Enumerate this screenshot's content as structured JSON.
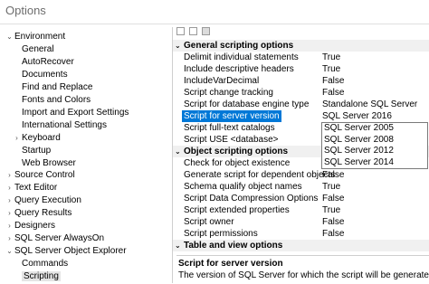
{
  "window": {
    "title": "Options"
  },
  "tree": {
    "nodes": [
      {
        "label": "Environment",
        "arrow": "⌄"
      },
      {
        "label": "General"
      },
      {
        "label": "AutoRecover"
      },
      {
        "label": "Documents"
      },
      {
        "label": "Find and Replace"
      },
      {
        "label": "Fonts and Colors"
      },
      {
        "label": "Import and Export Settings"
      },
      {
        "label": "International Settings"
      },
      {
        "label": "Keyboard",
        "arrow": "›"
      },
      {
        "label": "Startup"
      },
      {
        "label": "Web Browser"
      },
      {
        "label": "Source Control",
        "arrow": "›"
      },
      {
        "label": "Text Editor",
        "arrow": "›"
      },
      {
        "label": "Query Execution",
        "arrow": "›"
      },
      {
        "label": "Query Results",
        "arrow": "›"
      },
      {
        "label": "Designers",
        "arrow": "›"
      },
      {
        "label": "SQL Server AlwaysOn",
        "arrow": "›"
      },
      {
        "label": "SQL Server Object Explorer",
        "arrow": "⌄"
      },
      {
        "label": "Commands"
      },
      {
        "label": "Scripting"
      }
    ]
  },
  "grid": {
    "categories": {
      "general": "General scripting options",
      "object": "Object scripting options",
      "table": "Table and view options"
    },
    "rows": [
      {
        "name": "Delimit individual statements",
        "value": "True"
      },
      {
        "name": "Include descriptive headers",
        "value": "True"
      },
      {
        "name": "IncludeVarDecimal",
        "value": "False"
      },
      {
        "name": "Script change tracking",
        "value": "False"
      },
      {
        "name": "Script for database engine type",
        "value": "Standalone SQL Server"
      },
      {
        "name": "Script for server version",
        "value": "SQL Server 2016"
      },
      {
        "name": "Script full-text catalogs",
        "value": "SQL Server 2005"
      },
      {
        "name": "Script USE <database>",
        "value": "SQL Server 2008"
      },
      {
        "name": "Check for object existence",
        "value": ""
      },
      {
        "name": "Generate script for dependent objects",
        "value": "False"
      },
      {
        "name": "Schema qualify object names",
        "value": "True"
      },
      {
        "name": "Script Data Compression Options",
        "value": "False"
      },
      {
        "name": "Script extended properties",
        "value": "True"
      },
      {
        "name": "Script owner",
        "value": "False"
      },
      {
        "name": "Script permissions",
        "value": "False"
      }
    ],
    "dropdown_options": [
      "SQL Server 2005",
      "SQL Server 2008",
      "SQL Server 2012",
      "SQL Server 2014"
    ]
  },
  "description": {
    "title": "Script for server version",
    "text": "The version of SQL Server for which the script will be generated."
  }
}
